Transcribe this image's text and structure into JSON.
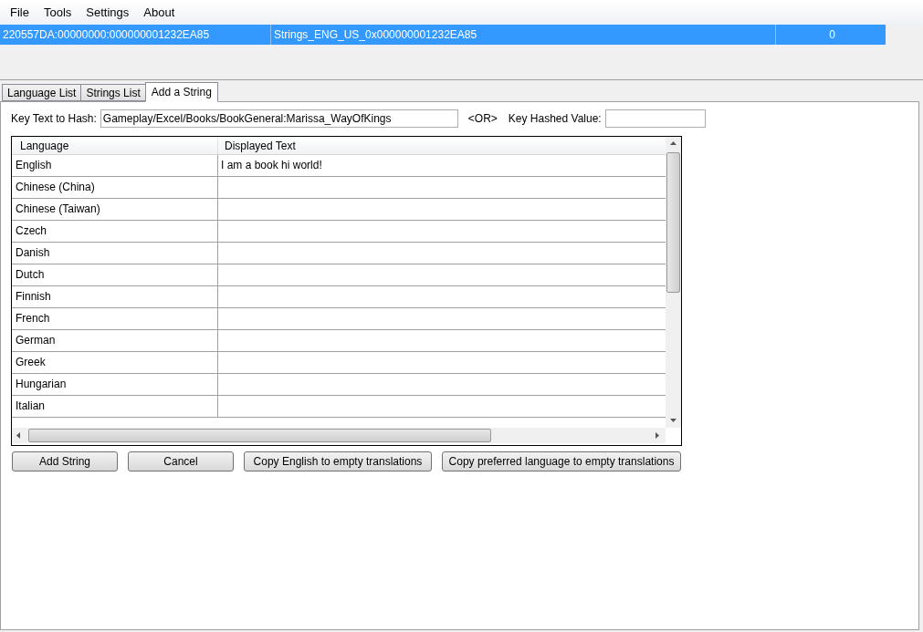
{
  "menu": [
    "File",
    "Tools",
    "Settings",
    "About"
  ],
  "file_list": {
    "rows": [
      {
        "cells": [
          "220557DA:00000000:000000001232EA85",
          "Strings_ENG_US_0x000000001232EA85",
          "0"
        ],
        "selected": true
      }
    ]
  },
  "tabs": [
    {
      "label": "Language List",
      "selected": false
    },
    {
      "label": "Strings List",
      "selected": false
    },
    {
      "label": "Add a String",
      "selected": true
    }
  ],
  "key_text": {
    "label": "Key Text to Hash:",
    "value": "Gameplay/Excel/Books/BookGeneral:Marissa_WayOfKings"
  },
  "or_label": "<OR>",
  "key_hashed": {
    "label": "Key Hashed Value:"
  },
  "grid": {
    "columns": [
      "Language",
      "Displayed Text"
    ],
    "rows": [
      [
        "English",
        "I am a book hi world!"
      ],
      [
        "Chinese (China)",
        ""
      ],
      [
        "Chinese (Taiwan)",
        ""
      ],
      [
        "Czech",
        ""
      ],
      [
        "Danish",
        ""
      ],
      [
        "Dutch",
        ""
      ],
      [
        "Finnish",
        ""
      ],
      [
        "French",
        ""
      ],
      [
        "German",
        ""
      ],
      [
        "Greek",
        ""
      ],
      [
        "Hungarian",
        ""
      ],
      [
        "Italian",
        ""
      ]
    ]
  },
  "buttons": [
    "Add String",
    "Cancel",
    "Copy English to empty translations",
    "Copy preferred language to empty translations"
  ]
}
